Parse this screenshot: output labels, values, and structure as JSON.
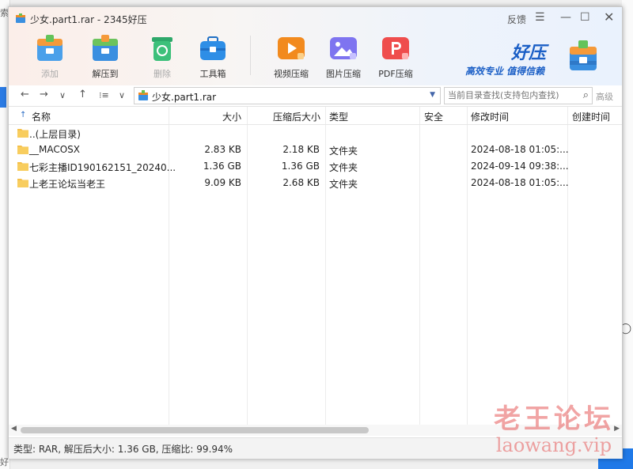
{
  "background": {
    "left_glyph_top": "索",
    "left_glyph_bottom": "好",
    "right_glyph": "◯"
  },
  "window": {
    "title": "少女.part1.rar - 2345好压",
    "feedback": "反馈",
    "menu_icon": "☰",
    "minimize_icon": "—",
    "maximize_icon": "☐",
    "close_icon": "✕"
  },
  "toolbar": [
    {
      "label": "添加",
      "icon": "add-icon",
      "color": "#4a9fe8",
      "disabled": true
    },
    {
      "label": "解压到",
      "icon": "extract-icon",
      "color": "#3a8fe0",
      "disabled": false
    },
    {
      "label": "删除",
      "icon": "recycle-icon",
      "color": "#3cc07a",
      "disabled": true
    },
    {
      "label": "工具箱",
      "icon": "toolbox-icon",
      "color": "#2e8ee6",
      "disabled": false
    },
    {
      "label": "视频压缩",
      "icon": "video-compress-icon",
      "color": "#f28a1e",
      "disabled": false
    },
    {
      "label": "图片压缩",
      "icon": "image-compress-icon",
      "color": "#7e74f0",
      "disabled": false
    },
    {
      "label": "PDF压缩",
      "icon": "pdf-compress-icon",
      "color": "#ef4d4d",
      "disabled": false
    }
  ],
  "brand": {
    "name": "好压",
    "slogan": "高效专业 值得信赖"
  },
  "nav": {
    "back": "←",
    "forward": "→",
    "history": "∨",
    "up": "↑",
    "view": "⁝≡",
    "view_dd": "∨",
    "path": "少女.part1.rar",
    "path_dropdown": "▼",
    "search_placeholder": "当前目录查找(支持包内查找)",
    "search_icon": "⌕",
    "advanced": "高级"
  },
  "columns": {
    "sort_icon": "↑",
    "name": "名称",
    "size": "大小",
    "packed": "压缩后大小",
    "type": "类型",
    "security": "安全",
    "modified": "修改时间",
    "created": "创建时间"
  },
  "rows": [
    {
      "name": "..(上层目录)",
      "size": "",
      "packed": "",
      "type": "",
      "security": "",
      "modified": ""
    },
    {
      "name": "__MACOSX",
      "size": "2.83 KB",
      "packed": "2.18 KB",
      "type": "文件夹",
      "security": "",
      "modified": "2024-08-18 01:05:..."
    },
    {
      "name": "七彩主播ID190162151_20240...",
      "size": "1.36 GB",
      "packed": "1.36 GB",
      "type": "文件夹",
      "security": "",
      "modified": "2024-09-14 09:38:..."
    },
    {
      "name": "上老王论坛当老王",
      "size": "9.09 KB",
      "packed": "2.68 KB",
      "type": "文件夹",
      "security": "",
      "modified": "2024-08-18 01:05:..."
    }
  ],
  "scrollbar": {
    "left": "◀",
    "right": "▶"
  },
  "status": "类型: RAR, 解压后大小: 1.36 GB, 压缩比: 99.94%",
  "watermark": {
    "line1": "老王论坛",
    "line2": "laowang.vip"
  }
}
